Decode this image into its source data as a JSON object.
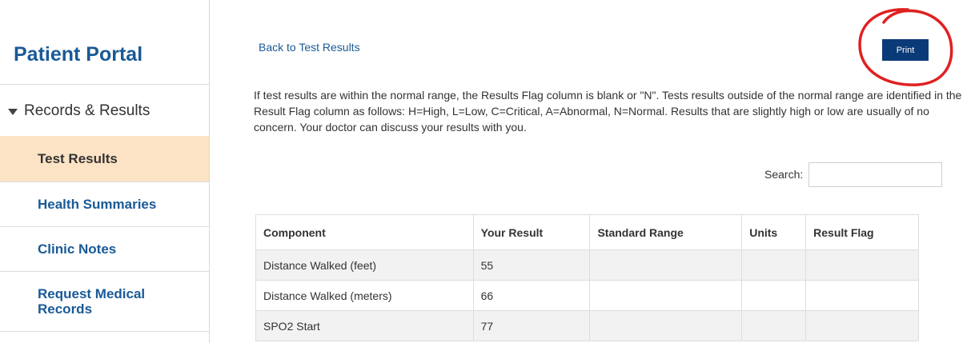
{
  "sidebar": {
    "title": "Patient Portal",
    "section": "Records & Results",
    "items": [
      {
        "label": "Test Results"
      },
      {
        "label": "Health Summaries"
      },
      {
        "label": "Clinic Notes"
      },
      {
        "label": "Request Medical Records"
      }
    ]
  },
  "main": {
    "back_link": "Back to Test Results",
    "print_label": "Print",
    "intro": "If test results are within the normal range, the Results Flag column is blank or \"N\". Tests results outside of the normal range are identified in the Result Flag column as follows: H=High, L=Low, C=Critical, A=Abnormal, N=Normal. Results that are slightly high or low are usually of no concern. Your doctor can discuss your results with you.",
    "search_label": "Search:",
    "search_value": ""
  },
  "table": {
    "headers": [
      "Component",
      "Your Result",
      "Standard Range",
      "Units",
      "Result Flag"
    ],
    "rows": [
      [
        "Distance Walked (feet)",
        "55",
        "",
        "",
        ""
      ],
      [
        "Distance Walked (meters)",
        "66",
        "",
        "",
        ""
      ],
      [
        "SPO2 Start",
        "77",
        "",
        "",
        ""
      ]
    ]
  },
  "colors": {
    "brand_blue": "#1a5a96",
    "active_nav_bg": "#fde3c5",
    "print_button_bg": "#0b3a78",
    "annotation_circle": "#e02020"
  }
}
